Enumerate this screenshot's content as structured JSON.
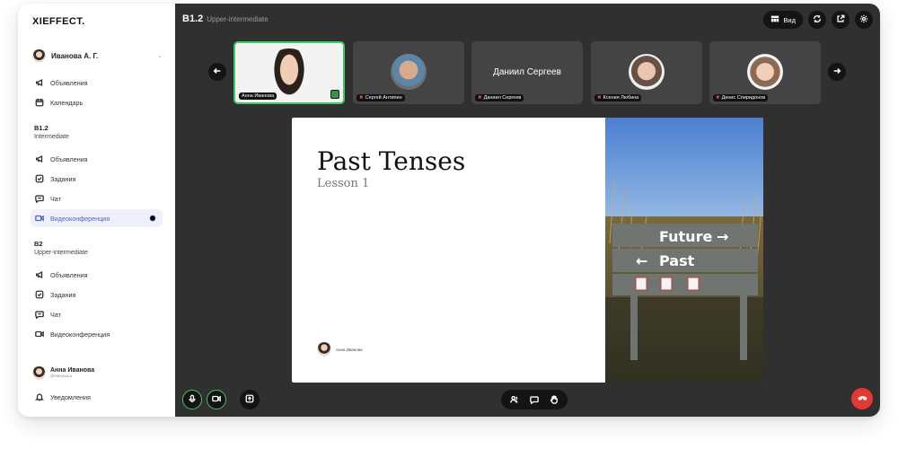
{
  "app": {
    "logo": "XIEFFECT."
  },
  "sidebar": {
    "user": {
      "name": "Иванова А. Г."
    },
    "top_items": [
      {
        "label": "Объявления",
        "icon": "megaphone-icon"
      },
      {
        "label": "Календарь",
        "icon": "calendar-icon"
      }
    ],
    "groups": [
      {
        "title": "B1.2",
        "subtitle": "Intermediate",
        "items": [
          {
            "label": "Объявления",
            "icon": "megaphone-icon"
          },
          {
            "label": "Задания",
            "icon": "task-icon"
          },
          {
            "label": "Чат",
            "icon": "chat-icon"
          },
          {
            "label": "Видеоконференция",
            "icon": "video-icon",
            "active": true
          }
        ]
      },
      {
        "title": "B2",
        "subtitle": "Upper-intermediate",
        "items": [
          {
            "label": "Объявления",
            "icon": "megaphone-icon"
          },
          {
            "label": "Задания",
            "icon": "task-icon"
          },
          {
            "label": "Чат",
            "icon": "chat-icon"
          },
          {
            "label": "Видеоконференция",
            "icon": "video-icon"
          }
        ]
      }
    ],
    "footer_user": {
      "name": "Анна Иванова",
      "handle": "@ivanova.a"
    },
    "notifications": "Уведомления"
  },
  "conference": {
    "title": "B1.2",
    "subtitle": "Upper-intermediate",
    "view_label": "Вид",
    "participants": [
      {
        "name": "Анна Иванова",
        "active": true,
        "video": true
      },
      {
        "name": "Сергей Антипин",
        "video": true,
        "muted": true
      },
      {
        "name": "Даниил Сергеев",
        "display": "Даниил Сергеев",
        "video": false,
        "muted": true
      },
      {
        "name": "Ксения Любина",
        "video": true,
        "muted": true
      },
      {
        "name": "Денис Спиридонов",
        "video": true,
        "muted": true
      }
    ],
    "slide": {
      "title": "Past Tenses",
      "subtitle": "Lesson 1",
      "author": "Анна Иванова",
      "sign_future": "Future",
      "sign_past": "Past"
    }
  },
  "colors": {
    "accent": "#4a62d6",
    "active_nav_bg": "#eef1fb",
    "stage_bg": "#303030",
    "speaking_border": "#45c46a",
    "end_call": "#e53935"
  }
}
